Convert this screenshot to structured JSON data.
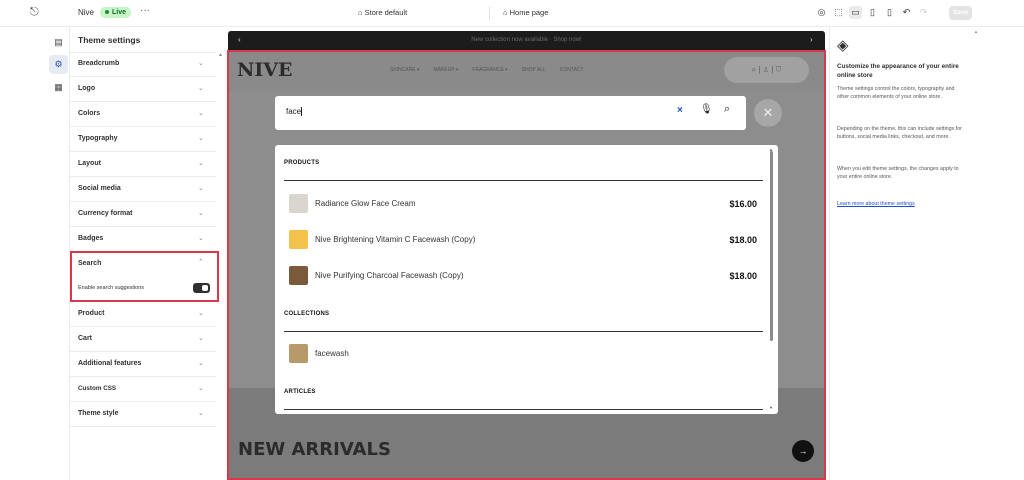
{
  "topbar": {
    "exit_icon": "exit-icon",
    "store_name": "Nive",
    "live_label": "Live",
    "more_label": "···",
    "store_default_label": "Store default",
    "home_page_label": "Home page",
    "save_label": "Save",
    "icons": [
      "inspector-icon",
      "select-icon",
      "desktop-icon",
      "tablet-icon",
      "mobile-icon",
      "undo-icon",
      "redo-icon"
    ]
  },
  "rail": {
    "icons": [
      "sections-icon",
      "theme-settings-icon",
      "apps-icon"
    ]
  },
  "sidebar": {
    "title": "Theme settings",
    "items_top": [
      {
        "label": "Breadcrumb"
      },
      {
        "label": "Logo"
      },
      {
        "label": "Colors"
      },
      {
        "label": "Typography"
      },
      {
        "label": "Layout"
      },
      {
        "label": "Social media"
      },
      {
        "label": "Currency format"
      },
      {
        "label": "Badges"
      }
    ],
    "search": {
      "label": "Search",
      "option_label": "Enable search suggestions",
      "option_enabled": true
    },
    "items_bottom": [
      {
        "label": "Product"
      },
      {
        "label": "Cart"
      },
      {
        "label": "Additional features"
      },
      {
        "label": "Custom CSS"
      },
      {
        "label": "Theme style"
      }
    ]
  },
  "preview": {
    "announcement": "New collection now available · Shop now!",
    "logo": "NIVE",
    "nav": [
      "SKINCARE ▾",
      "MAKEUP ▾",
      "FRAGRANCE ▾",
      "SHOP ALL",
      "CONTACT"
    ],
    "new_arrivals": "NEW ARRIVALS",
    "search": {
      "query": "face"
    },
    "results": {
      "products_heading": "PRODUCTS",
      "products": [
        {
          "name": "Radiance Glow Face Cream",
          "price": "$16.00",
          "thumb_color": "#d9d6d0"
        },
        {
          "name": "Nive Brightening Vitamin C Facewash (Copy)",
          "price": "$18.00",
          "thumb_color": "#f2c24a"
        },
        {
          "name": "Nive Purifying Charcoal Facewash (Copy)",
          "price": "$18.00",
          "thumb_color": "#7a5a3a"
        }
      ],
      "collections_heading": "COLLECTIONS",
      "collections": [
        {
          "name": "facewash",
          "thumb_color": "#b89a6a"
        }
      ],
      "articles_heading": "ARTICLES"
    }
  },
  "right_panel": {
    "heading": "Customize the appearance of your entire online store",
    "para1": "Theme settings control the colors, typography and other common elements of your online store.",
    "para2": "Depending on the theme, this can include settings for buttons, social media links, checkout, and more.",
    "para3": "When you edit theme settings, the changes apply to your entire online store.",
    "link": "Learn more about theme settings"
  },
  "colors": {
    "highlight": "#d9384a",
    "link": "#1f4fd1",
    "live_badge": "#c7f5c8"
  }
}
